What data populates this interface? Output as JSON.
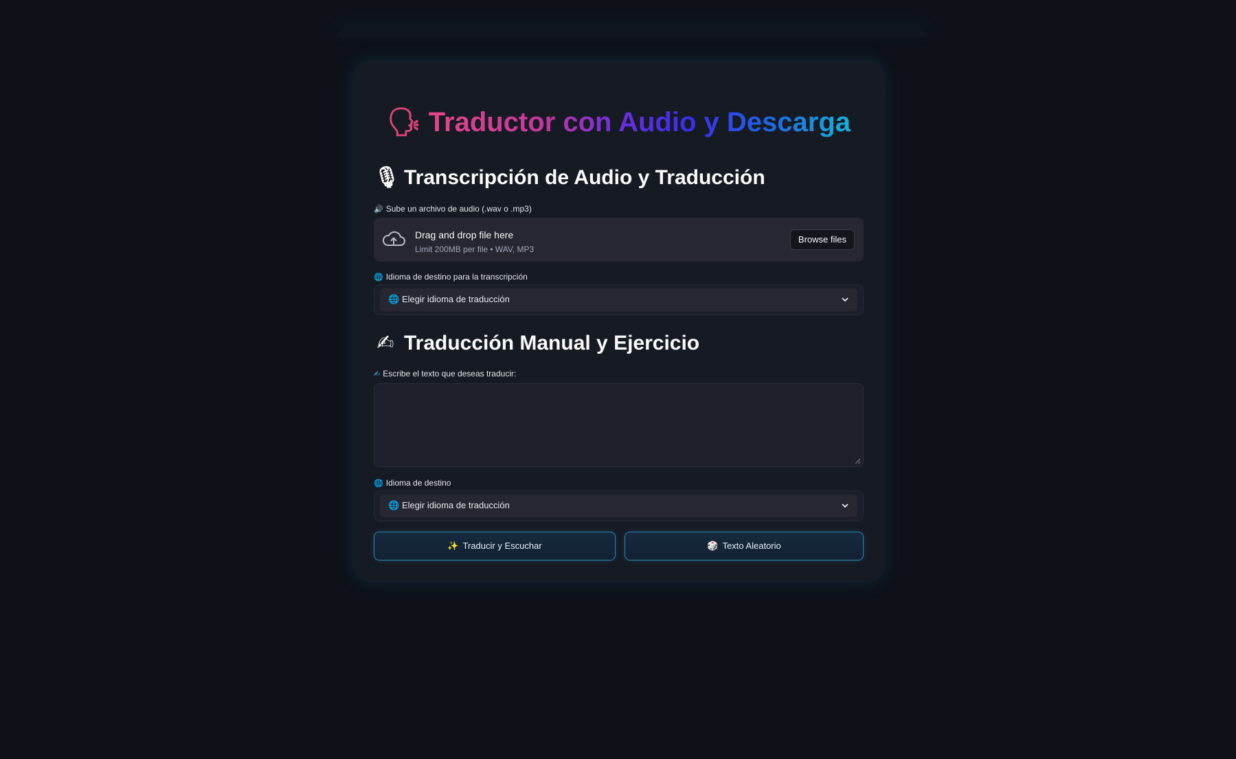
{
  "app": {
    "title_emoji": "🗣",
    "title": "Traductor con Audio y Descarga"
  },
  "transcription_section": {
    "icon": "🎙",
    "icon_name": "microphone-icon",
    "title": "Transcripción de Audio y Traducción",
    "upload_label_icon": "🔊",
    "upload_label": "Sube un archivo de audio (.wav o .mp3)",
    "uploader": {
      "main_text": "Drag and drop file here",
      "sub_text": "Limit 200MB per file • WAV, MP3",
      "browse_button": "Browse files"
    },
    "language_label_icon": "🌐",
    "language_label": "Idioma de destino para la transcripción",
    "language_select": {
      "icon": "🌐",
      "value": "Elegir idioma de traducción"
    }
  },
  "manual_section": {
    "icon": "✍",
    "icon_name": "writing-hand-icon",
    "title": "Traducción Manual y Ejercicio",
    "text_label_icon": "✍",
    "text_label": "Escribe el texto que deseas traducir:",
    "text_value": "",
    "language_label_icon": "🌐",
    "language_label": "Idioma de destino",
    "language_select": {
      "icon": "🌐",
      "value": "Elegir idioma de traducción"
    },
    "buttons": {
      "translate_icon": "✨",
      "translate_label": "Traducir y Escuchar",
      "random_icon": "🎲",
      "random_label": "Texto Aleatorio"
    }
  },
  "colors": {
    "background": "#0e1118",
    "card": "#161a23",
    "accent_glow": "#178cb4",
    "title_gradient": [
      "#e4468a",
      "#6b2ee0",
      "#1e63e6",
      "#14b3d8"
    ]
  }
}
